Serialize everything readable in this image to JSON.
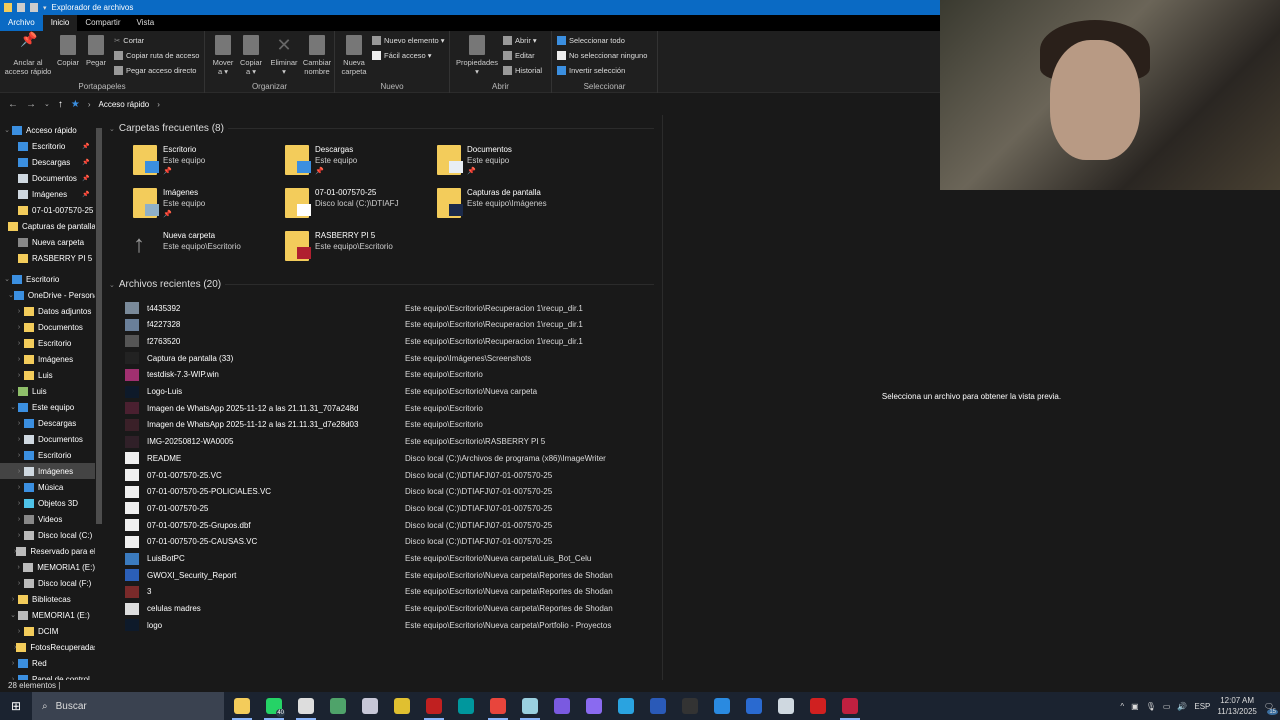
{
  "window": {
    "title": "Explorador de archivos"
  },
  "ribbon_tabs": [
    "Archivo",
    "Inicio",
    "Compartir",
    "Vista"
  ],
  "ribbon": {
    "portapapeles": {
      "label": "Portapapeles",
      "pin": "Anclar al\nacceso rápido",
      "copy": "Copiar",
      "paste": "Pegar",
      "cut": "Cortar",
      "copy_path": "Copiar ruta de acceso",
      "paste_shortcut": "Pegar acceso directo"
    },
    "organizar": {
      "label": "Organizar",
      "move": "Mover\na ▾",
      "copy_to": "Copiar\na ▾",
      "delete": "Eliminar\n▾",
      "rename": "Cambiar\nnombre"
    },
    "nuevo": {
      "label": "Nuevo",
      "new_folder": "Nueva\ncarpeta",
      "new_item": "Nuevo elemento ▾",
      "easy_access": "Fácil acceso ▾"
    },
    "abrir": {
      "label": "Abrir",
      "properties": "Propiedades\n▾",
      "open": "Abrir ▾",
      "edit": "Editar",
      "history": "Historial"
    },
    "seleccionar": {
      "label": "Seleccionar",
      "select_all": "Seleccionar todo",
      "select_none": "No seleccionar ninguno",
      "invert": "Invertir selección"
    }
  },
  "address": {
    "crumb": "Acceso rápido"
  },
  "nav": [
    {
      "label": "Acceso rápido",
      "level": 0,
      "chev": "⌄",
      "color": "#3b8fe0"
    },
    {
      "label": "Escritorio",
      "level": 1,
      "pin": true,
      "color": "#3b8fe0"
    },
    {
      "label": "Descargas",
      "level": 1,
      "pin": true,
      "color": "#3b8fe0"
    },
    {
      "label": "Documentos",
      "level": 1,
      "pin": true,
      "color": "#cfd8e0"
    },
    {
      "label": "Imágenes",
      "level": 1,
      "pin": true,
      "color": "#cfd8e0"
    },
    {
      "label": "07-01-007570-25",
      "level": 1,
      "color": "#f3cc5b"
    },
    {
      "label": "Capturas de pantalla",
      "level": 1,
      "color": "#f3cc5b"
    },
    {
      "label": "Nueva carpeta",
      "level": 1,
      "color": "#888"
    },
    {
      "label": "RASBERRY PI 5",
      "level": 1,
      "color": "#f3cc5b"
    },
    {
      "gap": true
    },
    {
      "label": "Escritorio",
      "level": 0,
      "chev": "⌄",
      "color": "#3b8fe0"
    },
    {
      "label": "OneDrive - Personal",
      "level": 1,
      "chev": "⌄",
      "color": "#3b8fe0"
    },
    {
      "label": "Datos adjuntos",
      "level": 2,
      "chev": "›",
      "color": "#f3cc5b"
    },
    {
      "label": "Documentos",
      "level": 2,
      "chev": "›",
      "color": "#f3cc5b"
    },
    {
      "label": "Escritorio",
      "level": 2,
      "chev": "›",
      "color": "#f3cc5b"
    },
    {
      "label": "Imágenes",
      "level": 2,
      "chev": "›",
      "color": "#f3cc5b"
    },
    {
      "label": "Luis",
      "level": 2,
      "chev": "›",
      "color": "#f3cc5b"
    },
    {
      "label": "Luis",
      "level": 1,
      "chev": "›",
      "color": "#8fbf6a"
    },
    {
      "label": "Este equipo",
      "level": 1,
      "chev": "⌄",
      "color": "#3b8fe0"
    },
    {
      "label": "Descargas",
      "level": 2,
      "chev": "›",
      "color": "#3b8fe0"
    },
    {
      "label": "Documentos",
      "level": 2,
      "chev": "›",
      "color": "#cfd8e0"
    },
    {
      "label": "Escritorio",
      "level": 2,
      "chev": "›",
      "color": "#3b8fe0"
    },
    {
      "label": "Imágenes",
      "level": 2,
      "chev": "›",
      "color": "#cfd8e0",
      "selected": true
    },
    {
      "label": "Música",
      "level": 2,
      "chev": "›",
      "color": "#3b8fe0"
    },
    {
      "label": "Objetos 3D",
      "level": 2,
      "chev": "›",
      "color": "#4fc3e8"
    },
    {
      "label": "Videos",
      "level": 2,
      "chev": "›",
      "color": "#888"
    },
    {
      "label": "Disco local (C:)",
      "level": 2,
      "chev": "›",
      "color": "#bbb"
    },
    {
      "label": "Reservado para el sistema",
      "level": 2,
      "chev": "›",
      "color": "#bbb"
    },
    {
      "label": "MEMORIA1 (E:)",
      "level": 2,
      "chev": "›",
      "color": "#bbb"
    },
    {
      "label": "Disco local (F:)",
      "level": 2,
      "chev": "›",
      "color": "#bbb"
    },
    {
      "label": "Bibliotecas",
      "level": 1,
      "chev": "›",
      "color": "#f3cc5b"
    },
    {
      "label": "MEMORIA1 (E:)",
      "level": 1,
      "chev": "⌄",
      "color": "#bbb"
    },
    {
      "label": "DCIM",
      "level": 2,
      "chev": "›",
      "color": "#f3cc5b"
    },
    {
      "label": "FotosRecuperadas",
      "level": 2,
      "chev": "›",
      "color": "#f3cc5b"
    },
    {
      "label": "Red",
      "level": 1,
      "chev": "›",
      "color": "#3b8fe0"
    },
    {
      "label": "Panel de control",
      "level": 1,
      "chev": "›",
      "color": "#3b8fe0"
    }
  ],
  "frequent": {
    "title": "Carpetas frecuentes (8)",
    "items": [
      {
        "name": "Escritorio",
        "location": "Este equipo",
        "pinned": true,
        "accent": "#3b8fe0"
      },
      {
        "name": "Descargas",
        "location": "Este equipo",
        "pinned": true,
        "accent": "#3b8fe0"
      },
      {
        "name": "Documentos",
        "location": "Este equipo",
        "pinned": true,
        "accent": "#e8eef4"
      },
      {
        "name": "Imágenes",
        "location": "Este equipo",
        "pinned": true,
        "accent": "#8fb0c8"
      },
      {
        "name": "07-01-007570-25",
        "location": "Disco local (C:)\\DTIAFJ",
        "pinned": false,
        "accent": "#ffffff"
      },
      {
        "name": "Capturas de pantalla",
        "location": "Este equipo\\Imágenes",
        "pinned": false,
        "accent": "#1b2a4a"
      },
      {
        "name": "Nueva carpeta",
        "location": "Este equipo\\Escritorio",
        "pinned": false,
        "accent": "arrow"
      },
      {
        "name": "RASBERRY PI 5",
        "location": "Este equipo\\Escritorio",
        "pinned": false,
        "accent": "#b02030"
      }
    ],
    "pin_glyph": "📌"
  },
  "recent": {
    "title": "Archivos recientes (20)",
    "items": [
      {
        "name": "t4435392",
        "path": "Este equipo\\Escritorio\\Recuperacion 1\\recup_dir.1",
        "icon": "#7a8a9a"
      },
      {
        "name": "f4227328",
        "path": "Este equipo\\Escritorio\\Recuperacion 1\\recup_dir.1",
        "icon": "#6a7f99"
      },
      {
        "name": "f2763520",
        "path": "Este equipo\\Escritorio\\Recuperacion 1\\recup_dir.1",
        "icon": "#555"
      },
      {
        "name": "Captura de pantalla (33)",
        "path": "Este equipo\\Imágenes\\Screenshots",
        "icon": "#222"
      },
      {
        "name": "testdisk-7.3-WIP.win",
        "path": "Este equipo\\Escritorio",
        "icon": "#a03070"
      },
      {
        "name": "Logo-Luis",
        "path": "Este equipo\\Escritorio\\Nueva carpeta",
        "icon": "#0e1a2a"
      },
      {
        "name": "Imagen de WhatsApp 2025-11-12 a las 21.11.31_707a248d",
        "path": "Este equipo\\Escritorio",
        "icon": "#4a2030"
      },
      {
        "name": "Imagen de WhatsApp 2025-11-12 a las 21.11.31_d7e28d03",
        "path": "Este equipo\\Escritorio",
        "icon": "#3a2028"
      },
      {
        "name": "IMG-20250812-WA0005",
        "path": "Este equipo\\Escritorio\\RASBERRY PI 5",
        "icon": "#302028"
      },
      {
        "name": "README",
        "path": "Disco local (C:)\\Archivos de programa (x86)\\ImageWriter",
        "icon": "#f0f0f0"
      },
      {
        "name": "07-01-007570-25.VC",
        "path": "Disco local (C:)\\DTIAFJ\\07-01-007570-25",
        "icon": "#f0f0f0"
      },
      {
        "name": "07-01-007570-25-POLICIALES.VC",
        "path": "Disco local (C:)\\DTIAFJ\\07-01-007570-25",
        "icon": "#f0f0f0"
      },
      {
        "name": "07-01-007570-25",
        "path": "Disco local (C:)\\DTIAFJ\\07-01-007570-25",
        "icon": "#f0f0f0"
      },
      {
        "name": "07-01-007570-25-Grupos.dbf",
        "path": "Disco local (C:)\\DTIAFJ\\07-01-007570-25",
        "icon": "#f0f0f0"
      },
      {
        "name": "07-01-007570-25-CAUSAS.VC",
        "path": "Disco local (C:)\\DTIAFJ\\07-01-007570-25",
        "icon": "#f0f0f0"
      },
      {
        "name": "LuisBotPC",
        "path": "Este equipo\\Escritorio\\Nueva carpeta\\Luis_Bot_Celu",
        "icon": "#3b7bbf"
      },
      {
        "name": "GWOXI_Security_Report",
        "path": "Este equipo\\Escritorio\\Nueva carpeta\\Reportes de Shodan",
        "icon": "#2b5fb8"
      },
      {
        "name": "3",
        "path": "Este equipo\\Escritorio\\Nueva carpeta\\Reportes de Shodan",
        "icon": "#7a2a2a"
      },
      {
        "name": "celulas madres",
        "path": "Este equipo\\Escritorio\\Nueva carpeta\\Reportes de Shodan",
        "icon": "#ddd"
      },
      {
        "name": "logo",
        "path": "Este equipo\\Escritorio\\Nueva carpeta\\Portfolio - Proyectos",
        "icon": "#0e1a2a"
      }
    ]
  },
  "preview": {
    "message": "Selecciona un archivo para obtener la vista previa."
  },
  "status": {
    "count": "28 elementos"
  },
  "taskbar": {
    "search_placeholder": "Buscar",
    "apps": [
      {
        "name": "file-explorer",
        "color": "#f3cc5b",
        "running": true
      },
      {
        "name": "whatsapp",
        "color": "#25d366",
        "running": true,
        "badge": "40"
      },
      {
        "name": "chatgpt",
        "color": "#dddddd",
        "running": true
      },
      {
        "name": "visual-studio",
        "color": "#4fa36a"
      },
      {
        "name": "app-bird",
        "color": "#c8c8d8"
      },
      {
        "name": "app-layers",
        "color": "#e0c030"
      },
      {
        "name": "app-circle",
        "color": "#c02020",
        "running": true
      },
      {
        "name": "arduino",
        "color": "#00979d"
      },
      {
        "name": "chrome",
        "color": "#e8453c",
        "running": true
      },
      {
        "name": "app-notes",
        "color": "#9ad0e0",
        "running": true
      },
      {
        "name": "app-purple",
        "color": "#7a5ae0"
      },
      {
        "name": "proton-vpn",
        "color": "#8a6af0"
      },
      {
        "name": "telegram",
        "color": "#2aa3e0"
      },
      {
        "name": "powershell",
        "color": "#2a5ab8"
      },
      {
        "name": "terminal",
        "color": "#333333"
      },
      {
        "name": "vscode",
        "color": "#2a8ae0"
      },
      {
        "name": "app-r",
        "color": "#2a6ad0"
      },
      {
        "name": "steam",
        "color": "#cfd8e0"
      },
      {
        "name": "app-w",
        "color": "#d02020"
      },
      {
        "name": "app-camera",
        "color": "#c02040",
        "running": true
      }
    ],
    "language": "ESP",
    "time": "12:07 AM",
    "date": "11/13/2025",
    "notifications": "15"
  }
}
